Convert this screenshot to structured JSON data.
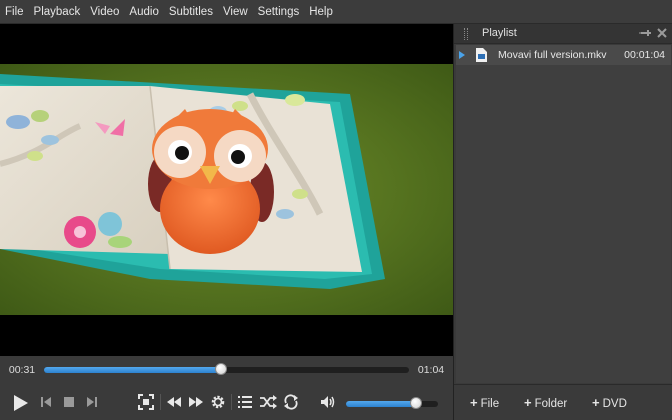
{
  "menu": [
    "File",
    "Playback",
    "Video",
    "Audio",
    "Subtitles",
    "View",
    "Settings",
    "Help"
  ],
  "player": {
    "current_time": "00:31",
    "total_time": "01:04",
    "progress": 0.4844,
    "volume": 0.76
  },
  "controls": {
    "icons": [
      "play-icon",
      "previous-icon",
      "stop-icon",
      "next-icon",
      "fullscreen-icon",
      "rewind-icon",
      "fast-forward-icon",
      "settings-gear-icon",
      "playlist-icon",
      "shuffle-icon",
      "repeat-icon",
      "volume-icon"
    ]
  },
  "playlist": {
    "title": "Playlist",
    "items": [
      {
        "name": "Movavi full version.mkv",
        "duration": "00:01:04"
      }
    ],
    "buttons": {
      "file": "File",
      "folder": "Folder",
      "dvd": "DVD"
    }
  },
  "colors": {
    "accent": "#3a93e0",
    "background": "#3a3a3a",
    "menubar": "#3c3c3c"
  }
}
